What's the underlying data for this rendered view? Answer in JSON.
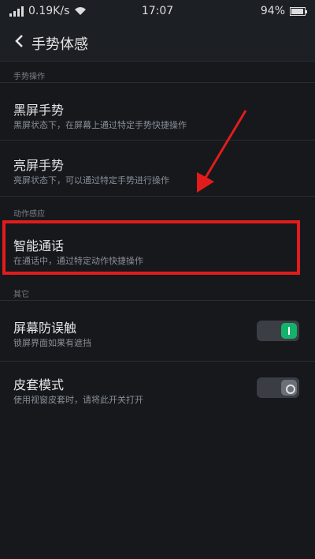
{
  "status_bar": {
    "network_speed": "0.19K/s",
    "time": "17:07",
    "battery": "94%",
    "battery_level": 0.94
  },
  "header": {
    "title": "手势体感"
  },
  "sections": [
    {
      "label": "手势操作"
    },
    {
      "label": "动作感应"
    },
    {
      "label": "其它"
    }
  ],
  "rows": [
    {
      "name": "黑屏手势",
      "desc": "黑屏状态下，在屏幕上通过特定手势快捷操作"
    },
    {
      "name": "亮屏手势",
      "desc": "亮屏状态下，可以通过特定手势进行操作"
    },
    {
      "name": "智能通话",
      "desc": "在通话中，通过特定动作快捷操作"
    },
    {
      "name": "屏幕防误触",
      "desc": "锁屏界面如果有遮挡",
      "toggle": "on"
    },
    {
      "name": "皮套模式",
      "desc": "使用视窗皮套时，请将此开关打开",
      "toggle": "off"
    }
  ],
  "colors": {
    "highlight": "#e21c1c",
    "switch_on": "#13b36b"
  }
}
